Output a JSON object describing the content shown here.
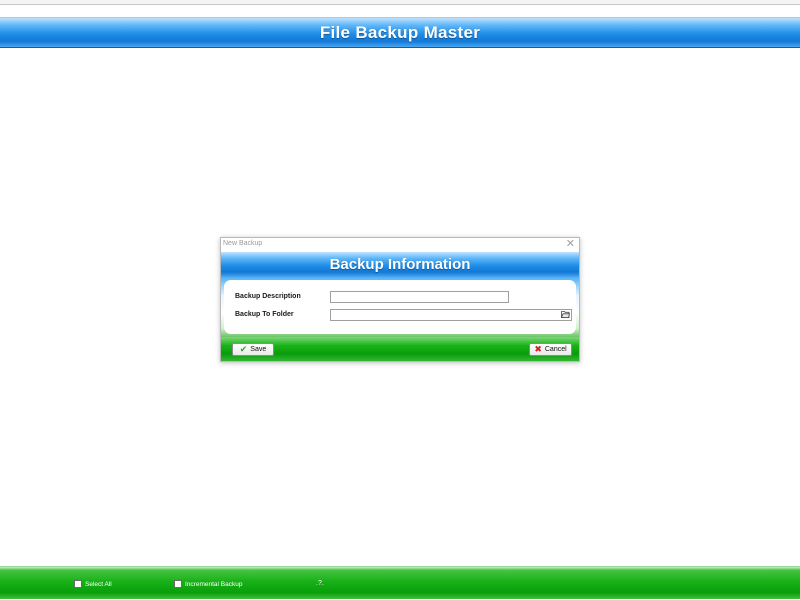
{
  "app": {
    "title": "File Backup Master"
  },
  "dialog": {
    "window_title": "New Backup",
    "close_glyph": "✕",
    "header_title": "Backup Information",
    "fields": {
      "description_label": "Backup Description",
      "description_value": "",
      "folder_label": "Backup To Folder",
      "folder_value": ""
    },
    "buttons": {
      "save_label": "Save",
      "cancel_label": "Cancel"
    },
    "icons": {
      "save": "check-icon",
      "cancel": "x-icon",
      "browse": "folder-open-icon"
    }
  },
  "bottom_bar": {
    "select_all_label": "Select All",
    "select_all_checked": false,
    "incremental_label": "Incremental Backup",
    "incremental_checked": false,
    "status_text": ".?."
  },
  "colors": {
    "header_blue": "#1f8de8",
    "footer_green": "#18b118",
    "background": "#ffffff"
  }
}
